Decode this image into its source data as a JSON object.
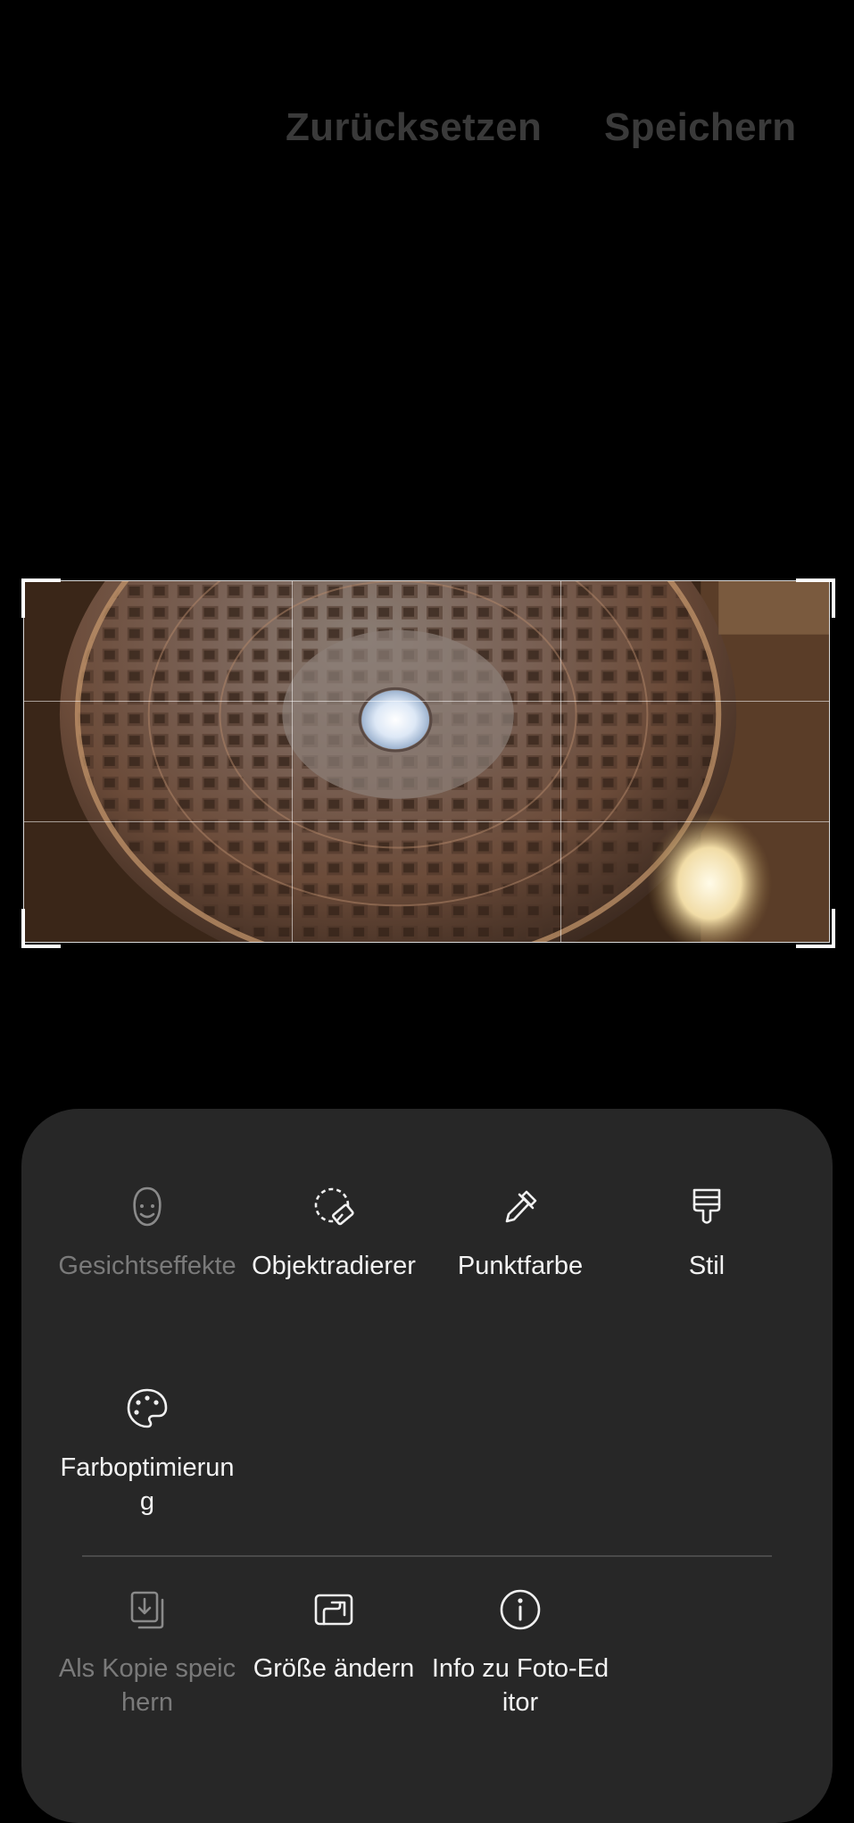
{
  "header": {
    "reset_label": "Zurücksetzen",
    "save_label": "Speichern"
  },
  "tools": [
    {
      "label": "Gesichtseffekte",
      "icon": "face-icon",
      "enabled": false
    },
    {
      "label": "Objektradierer",
      "icon": "object-eraser-icon",
      "enabled": true
    },
    {
      "label": "Punktfarbe",
      "icon": "color-picker-icon",
      "enabled": true
    },
    {
      "label": "Stil",
      "icon": "brush-style-icon",
      "enabled": true
    },
    {
      "label": "Farboptimierung",
      "icon": "palette-icon",
      "enabled": true
    }
  ],
  "actions": [
    {
      "label": "Als Kopie speichern",
      "icon": "save-copy-icon",
      "enabled": false
    },
    {
      "label": "Größe ändern",
      "icon": "resize-icon",
      "enabled": true
    },
    {
      "label": "Info zu Foto-Editor",
      "icon": "info-icon",
      "enabled": true
    }
  ],
  "colors": {
    "background": "#000000",
    "sheet": "#272727",
    "header_text": "#3a3a3a",
    "enabled_text": "#f2f2f2",
    "disabled_text": "#7a7a7a"
  }
}
